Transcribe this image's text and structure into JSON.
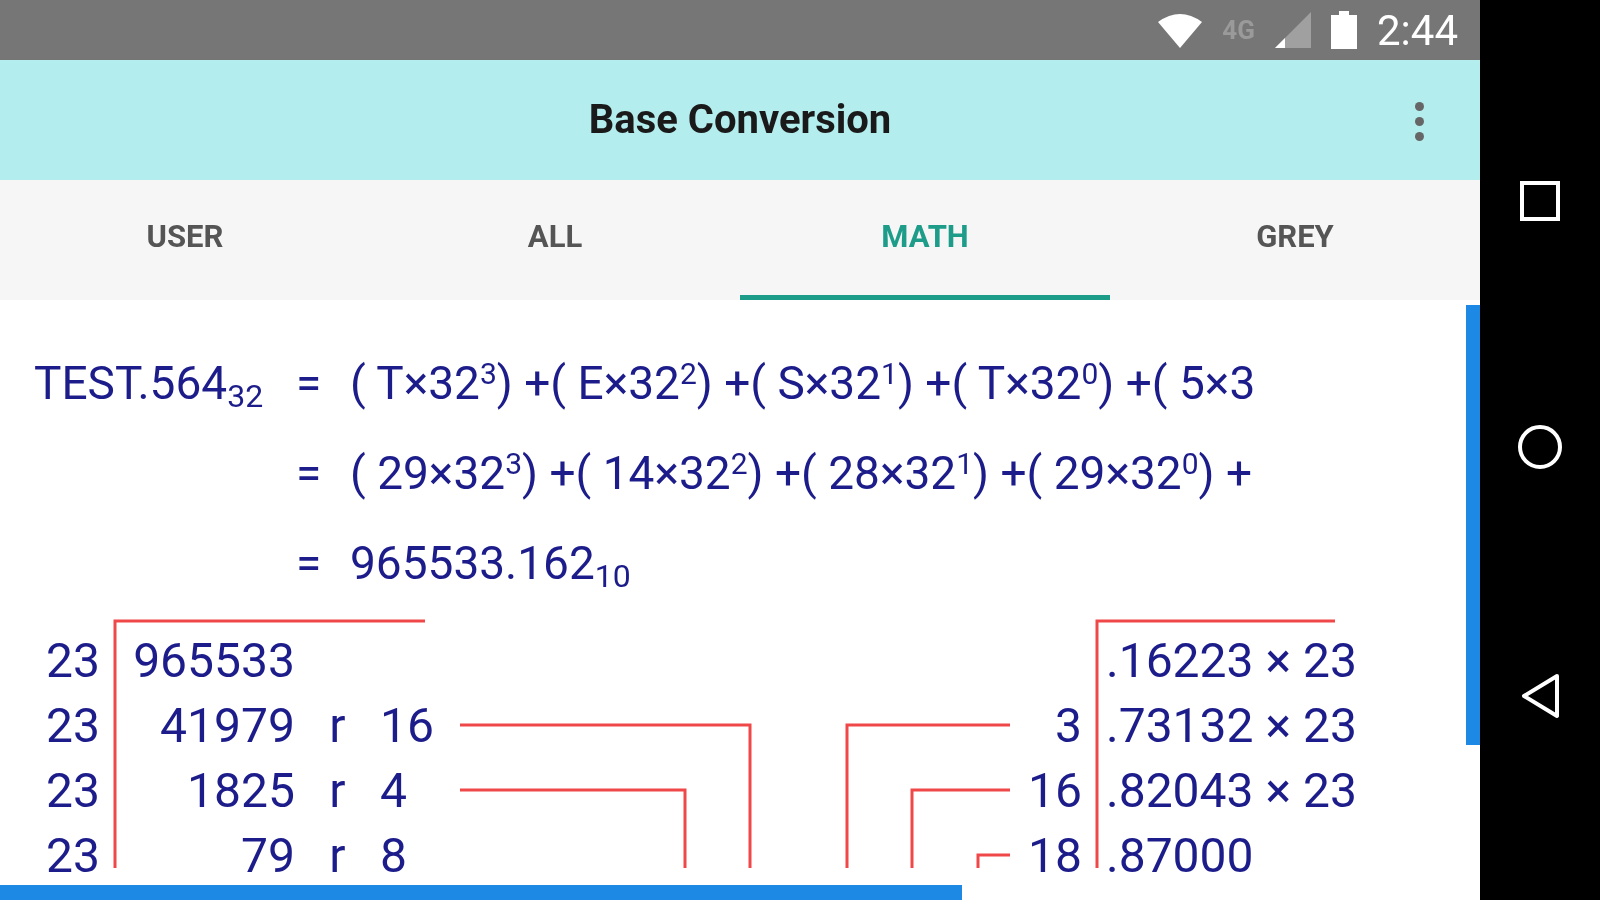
{
  "status_bar": {
    "network": "4G",
    "time": "2:44"
  },
  "app_bar": {
    "title": "Base Conversion"
  },
  "tabs": [
    {
      "label": "USER",
      "selected": false
    },
    {
      "label": "ALL",
      "selected": false
    },
    {
      "label": "MATH",
      "selected": true
    },
    {
      "label": "GREY",
      "selected": false
    }
  ],
  "formula": {
    "number": "TEST.564$_{32}$",
    "lines": [
      {
        "operator": "=",
        "expression": "( T×32$^{3}$) +( E×32$^{2}$) +( S×32$^{1}$) +( T×32$^{0}$) +( 5×3"
      },
      {
        "operator": "=",
        "expression": "( 29×32$^{3}$) +( 14×32$^{2}$) +( 28×32$^{1}$) +( 29×32$^{0}$) +"
      },
      {
        "operator": "=",
        "expression": "965533.162$_{10}$"
      }
    ]
  },
  "integer_division": {
    "rows": [
      {
        "divisor": "23",
        "quotient": "965533"
      },
      {
        "divisor": "23",
        "quotient": "41979",
        "marker": "r",
        "remainder": "16"
      },
      {
        "divisor": "23",
        "quotient": "1825",
        "marker": "r",
        "remainder": "4"
      },
      {
        "divisor": "23",
        "quotient": "79",
        "marker": "r",
        "remainder": "8"
      }
    ]
  },
  "fraction_multiplication": {
    "rows": [
      {
        "product": ".16223 × 23"
      },
      {
        "digit": "3",
        "product": ".73132 × 23"
      },
      {
        "digit": "16",
        "product": ".82043 × 23"
      },
      {
        "digit": "18",
        "product": ".87000"
      }
    ]
  }
}
